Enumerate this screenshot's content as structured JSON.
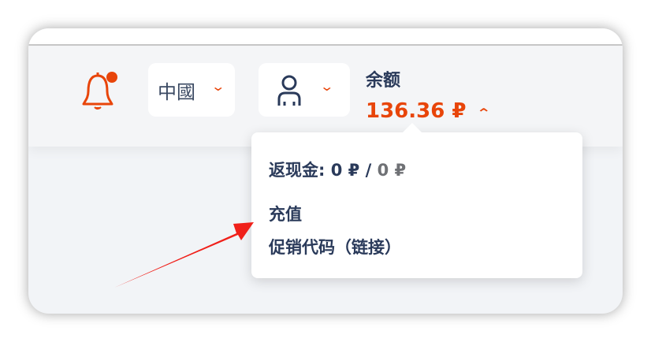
{
  "header": {
    "language": "中國",
    "balance_label": "余额",
    "balance_value": "136.36 ₽",
    "notification_dot": true
  },
  "popup": {
    "cashback_label": "返现金:",
    "cashback_current": "0 ₽",
    "cashback_separator": "/",
    "cashback_total": "0 ₽",
    "items": [
      {
        "label": "充值"
      },
      {
        "label": "促销代码（链接）"
      }
    ]
  },
  "colors": {
    "accent": "#e8450a",
    "text": "#2a3a5a"
  }
}
